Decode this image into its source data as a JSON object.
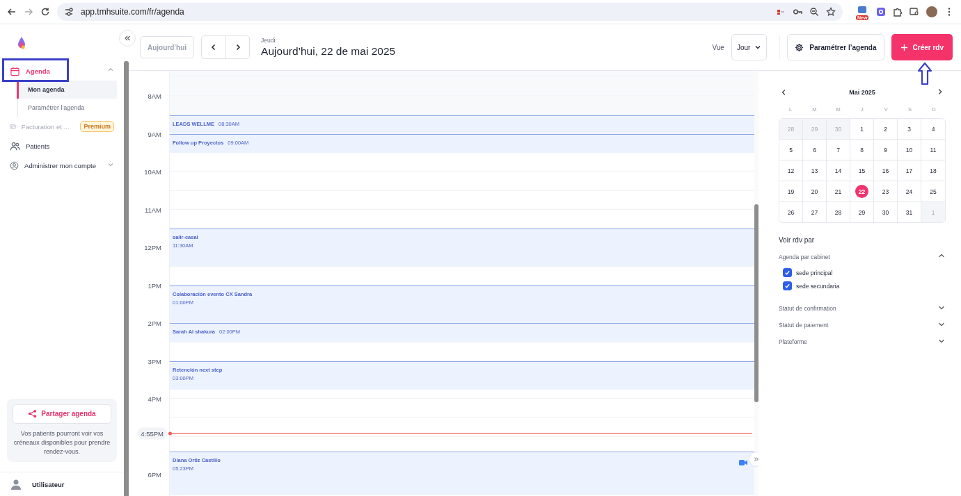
{
  "browser": {
    "url": "app.tmhsuite.com/fr/agenda",
    "extension_badge": "New"
  },
  "sidebar": {
    "items": [
      {
        "label": "Agenda",
        "selected": true,
        "disabled": false,
        "expanded": true,
        "children": [
          {
            "label": "Mon agenda",
            "selected": true
          },
          {
            "label": "Paramétrer l'agenda",
            "selected": false
          }
        ]
      },
      {
        "label": "Facturation et ...",
        "selected": false,
        "disabled": true,
        "badge": "Premium"
      },
      {
        "label": "Patients",
        "selected": false,
        "disabled": false
      },
      {
        "label": "Administrer mon compte",
        "selected": false,
        "disabled": false,
        "expanded": false
      }
    ],
    "share": {
      "button": "Partager agenda",
      "description": "Vos patients pourront voir vos créneaux disponibles pour prendre rendez-vous."
    },
    "user": "Utilisateur"
  },
  "toolbar": {
    "today": "Aujourd’hui",
    "weekday": "Jeudi",
    "title": "Aujourd’hui, 22 de mai 2025",
    "view_label": "Vue",
    "view": "Jour",
    "settings": "Paramétrer l’agenda",
    "create": "Créer rdv"
  },
  "calendar": {
    "hour_labels": [
      "8AM",
      "9AM",
      "10AM",
      "11AM",
      "12PM",
      "1PM",
      "2PM",
      "3PM",
      "4PM",
      "6PM"
    ],
    "now_label": "4:55PM",
    "events": [
      {
        "title": "LEADS WELLME",
        "time": "08:30AM",
        "kind": "short",
        "video_call": false
      },
      {
        "title": "Follow up Proyectos",
        "time": "09:00AM",
        "kind": "short",
        "video_call": false
      },
      {
        "title": "salir-casal",
        "time": "11:30AM",
        "kind": "long",
        "video_call": false
      },
      {
        "title": "Colaboración evento CX Sandra",
        "time": "01:00PM",
        "kind": "long",
        "video_call": false
      },
      {
        "title": "Sarah Al shakura",
        "time": "02:00PM",
        "kind": "short",
        "video_call": false
      },
      {
        "title": "Retención next step",
        "time": "03:00PM",
        "kind": "long",
        "video_call": false
      },
      {
        "title": "Diana Ortiz Castillo",
        "time": "05:23PM",
        "kind": "long",
        "video_call": true
      }
    ]
  },
  "mini_calendar": {
    "month": "Mai 2025",
    "weekdays": [
      "L",
      "M",
      "M",
      "J",
      "V",
      "S",
      "D"
    ],
    "days": [
      {
        "day": "28",
        "outside": true,
        "selected": false
      },
      {
        "day": "29",
        "outside": true,
        "selected": false
      },
      {
        "day": "30",
        "outside": true,
        "selected": false
      },
      {
        "day": "1",
        "outside": false,
        "selected": false
      },
      {
        "day": "2",
        "outside": false,
        "selected": false
      },
      {
        "day": "3",
        "outside": false,
        "selected": false
      },
      {
        "day": "4",
        "outside": false,
        "selected": false
      },
      {
        "day": "5",
        "outside": false,
        "selected": false
      },
      {
        "day": "6",
        "outside": false,
        "selected": false
      },
      {
        "day": "7",
        "outside": false,
        "selected": false
      },
      {
        "day": "8",
        "outside": false,
        "selected": false
      },
      {
        "day": "9",
        "outside": false,
        "selected": false
      },
      {
        "day": "10",
        "outside": false,
        "selected": false
      },
      {
        "day": "11",
        "outside": false,
        "selected": false
      },
      {
        "day": "12",
        "outside": false,
        "selected": false
      },
      {
        "day": "13",
        "outside": false,
        "selected": false
      },
      {
        "day": "14",
        "outside": false,
        "selected": false
      },
      {
        "day": "15",
        "outside": false,
        "selected": false
      },
      {
        "day": "16",
        "outside": false,
        "selected": false
      },
      {
        "day": "17",
        "outside": false,
        "selected": false
      },
      {
        "day": "18",
        "outside": false,
        "selected": false
      },
      {
        "day": "19",
        "outside": false,
        "selected": false
      },
      {
        "day": "20",
        "outside": false,
        "selected": false
      },
      {
        "day": "21",
        "outside": false,
        "selected": false
      },
      {
        "day": "22",
        "outside": false,
        "selected": true
      },
      {
        "day": "23",
        "outside": false,
        "selected": false
      },
      {
        "day": "24",
        "outside": false,
        "selected": false
      },
      {
        "day": "25",
        "outside": false,
        "selected": false
      },
      {
        "day": "26",
        "outside": false,
        "selected": false
      },
      {
        "day": "27",
        "outside": false,
        "selected": false
      },
      {
        "day": "28",
        "outside": false,
        "selected": false
      },
      {
        "day": "29",
        "outside": false,
        "selected": false
      },
      {
        "day": "30",
        "outside": false,
        "selected": false
      },
      {
        "day": "31",
        "outside": false,
        "selected": false
      },
      {
        "day": "1",
        "outside": true,
        "selected": false
      }
    ]
  },
  "filters": {
    "title": "Voir rdv par",
    "groups": [
      {
        "label": "Agenda par cabinet",
        "expanded": true,
        "options": [
          {
            "label": "sede principal",
            "checked": true
          },
          {
            "label": "sede secundaria",
            "checked": true
          }
        ]
      },
      {
        "label": "Statut de confirmation",
        "expanded": false
      },
      {
        "label": "Statut de paiement",
        "expanded": false
      },
      {
        "label": "Plateforme",
        "expanded": false
      }
    ]
  }
}
